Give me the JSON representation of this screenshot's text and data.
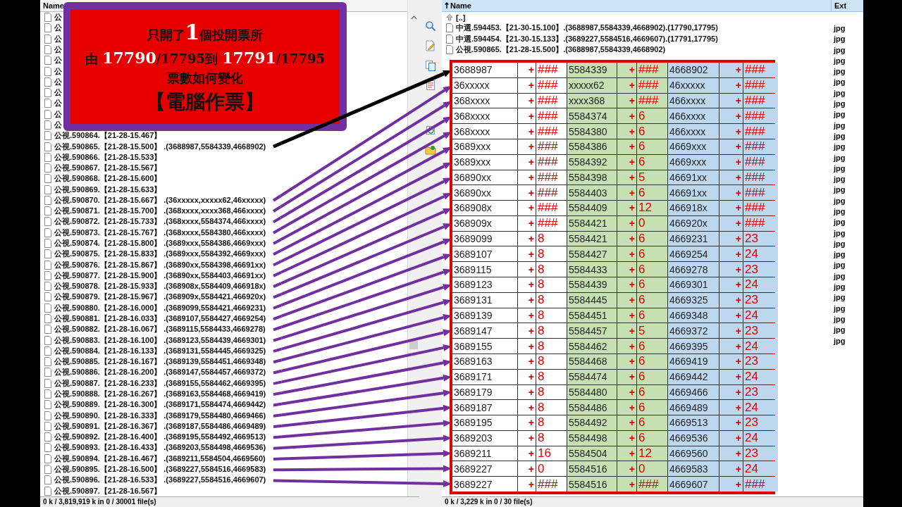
{
  "left_panel": {
    "header": "Name",
    "rows": [
      {
        "name": "公"
      },
      {
        "name": "公"
      },
      {
        "name": "公"
      },
      {
        "name": "公"
      },
      {
        "name": "公"
      },
      {
        "name": "公"
      },
      {
        "name": "公"
      },
      {
        "name": "公"
      },
      {
        "name": "公"
      },
      {
        "name": "公"
      },
      {
        "name": "公"
      },
      {
        "name": "公視.590864.【21-28-15.467】"
      },
      {
        "name": "公視.590865.【21-28-15.500】 .(3688987,5584339,4668902)",
        "color": "#000000"
      },
      {
        "name": "公視.590866.【21-28-15.533】"
      },
      {
        "name": "公視.590867.【21-28-15.567】"
      },
      {
        "name": "公視.590868.【21-28-15.600】"
      },
      {
        "name": "公視.590869.【21-28-15.633】"
      },
      {
        "name": "公視.590870.【21-28-15.667】 .(36xxxxx,xxxxx62,46xxxxx)",
        "color": "#7030a0"
      },
      {
        "name": "公視.590871.【21-28-15.700】 .(368xxxx,xxxx368,466xxxx)",
        "color": "#7030a0"
      },
      {
        "name": "公視.590872.【21-28-15.733】 .(368xxxx,5584374,466xxxx)",
        "color": "#7030a0"
      },
      {
        "name": "公視.590873.【21-28-15.767】 .(368xxxx,5584380,466xxxx)",
        "color": "#7030a0"
      },
      {
        "name": "公視.590874.【21-28-15.800】 .(3689xxx,5584386,4669xxx)",
        "color": "#7030a0"
      },
      {
        "name": "公視.590875.【21-28-15.833】 .(3689xxx,5584392,4669xxx)",
        "color": "#7030a0"
      },
      {
        "name": "公視.590876.【21-28-15.867】 .(36890xx,5584398,46691xx)",
        "color": "#7030a0"
      },
      {
        "name": "公視.590877.【21-28-15.900】 .(36890xx,5584403,46691xx)",
        "color": "#7030a0"
      },
      {
        "name": "公視.590878.【21-28-15.933】 .(368908x,5584409,466918x)",
        "color": "#7030a0"
      },
      {
        "name": "公視.590879.【21-28-15.967】 .(368909x,5584421,466920x)",
        "color": "#7030a0"
      },
      {
        "name": "公視.590880.【21-28-16.000】 .(3689099,5584421,4669231)",
        "color": "#7030a0"
      },
      {
        "name": "公視.590881.【21-28-16.033】 .(3689107,5584427,4669254)",
        "color": "#7030a0"
      },
      {
        "name": "公視.590882.【21-28-16.067】 .(3689115,5584433,4669278)",
        "color": "#7030a0"
      },
      {
        "name": "公視.590883.【21-28-16.100】 .(3689123,5584439,4669301)",
        "color": "#7030a0"
      },
      {
        "name": "公視.590884.【21-28-16.133】 .(3689131,5584445,4669325)",
        "color": "#7030a0"
      },
      {
        "name": "公視.590885.【21-28-16.167】 .(3689139,5584451,4669348)",
        "color": "#7030a0"
      },
      {
        "name": "公視.590886.【21-28-16.200】 .(3689147,5584457,4669372)",
        "color": "#7030a0"
      },
      {
        "name": "公視.590887.【21-28-16.233】 .(3689155,5584462,4669395)",
        "color": "#7030a0"
      },
      {
        "name": "公視.590888.【21-28-16.267】 .(3689163,5584468,4669419)",
        "color": "#7030a0"
      },
      {
        "name": "公視.590889.【21-28-16.300】 .(3689171,5584474,4669442)",
        "color": "#7030a0"
      },
      {
        "name": "公視.590890.【21-28-16.333】 .(3689179,5584480,4669466)",
        "color": "#7030a0"
      },
      {
        "name": "公視.590891.【21-28-16.367】 .(3689187,5584486,4669489)",
        "color": "#7030a0"
      },
      {
        "name": "公視.590892.【21-28-16.400】 .(3689195,5584492,4669513)",
        "color": "#7030a0"
      },
      {
        "name": "公視.590893.【21-28-16.433】 .(3689203,5584498,4669536)",
        "color": "#7030a0"
      },
      {
        "name": "公視.590894.【21-28-16.467】 .(3689211,5584504,4669560)",
        "color": "#7030a0"
      },
      {
        "name": "公視.590895.【21-28-16.500】 .(3689227,5584516,4669583)",
        "color": "#7030a0"
      },
      {
        "name": "公視.590896.【21-28-16.533】 .(3689227,5584516,4669607)",
        "color": "#7030a0"
      },
      {
        "name": "公視.590897.【21-28-16.567】"
      }
    ],
    "status": "0 k / 3,819,919 k in 0 / 30001 file(s)"
  },
  "right_panel": {
    "header_name": "Name",
    "header_ext": "Ext",
    "parent": "[..]",
    "rows": [
      {
        "name": "中選.594453.【21-30-15.100】.(3688987,5584339,4668902).(17790,17795)",
        "ext": "jpg"
      },
      {
        "name": "中選.594454.【21-30-15.133】.(3689227,5584516,4669607).(17791,17795)",
        "ext": "jpg"
      },
      {
        "name": "公視.590865.【21-28-15.500】.(3688987,5584339,4668902)",
        "ext": "jpg"
      },
      {
        "ext": "jpg"
      },
      {
        "ext": "jpg"
      },
      {
        "ext": "jpg"
      },
      {
        "ext": "jpg"
      },
      {
        "ext": "jpg"
      },
      {
        "ext": "jpg"
      },
      {
        "ext": "jpg"
      },
      {
        "ext": "jpg"
      },
      {
        "ext": "jpg"
      },
      {
        "ext": "jpg"
      },
      {
        "ext": "jpg"
      },
      {
        "ext": "jpg"
      },
      {
        "ext": "jpg"
      },
      {
        "ext": "jpg"
      },
      {
        "ext": "jpg"
      },
      {
        "ext": "jpg"
      },
      {
        "ext": "jpg"
      },
      {
        "ext": "jpg"
      },
      {
        "ext": "jpg"
      },
      {
        "ext": "jpg"
      },
      {
        "ext": "jpg"
      },
      {
        "ext": "jpg"
      },
      {
        "ext": "jpg"
      },
      {
        "ext": "jpg"
      },
      {
        "ext": "jpg"
      },
      {
        "ext": "jpg"
      },
      {
        "ext": "jpg"
      }
    ],
    "status": "0 k / 3,229 k in 0 / 30 file(s)"
  },
  "callout": {
    "lines": [
      {
        "kind": "normal",
        "parts": [
          {
            "text": "只開了",
            "kind": "plain"
          },
          {
            "text": "1",
            "kind": "big"
          },
          {
            "text": "個投開票所",
            "kind": "plain"
          }
        ]
      },
      {
        "kind": "normal",
        "parts": [
          {
            "text": "由 ",
            "kind": "plain"
          },
          {
            "text": "17790",
            "kind": "light"
          },
          {
            "text": "/17795到 ",
            "kind": "plain"
          },
          {
            "text": "17791",
            "kind": "light"
          },
          {
            "text": "/17795",
            "kind": "plain"
          }
        ]
      },
      {
        "kind": "normal",
        "parts": [
          {
            "text": "票數如何變化",
            "kind": "plain"
          }
        ]
      },
      {
        "kind": "large",
        "parts": [
          {
            "text": "【電腦作票】",
            "kind": "plain"
          }
        ]
      }
    ]
  },
  "vote_table": {
    "rows": [
      [
        "3688987",
        "+",
        "###",
        "5584339",
        "+",
        "###",
        "4668902",
        "+",
        "###"
      ],
      [
        "36xxxxx",
        "+",
        "###",
        "xxxxx62",
        "+",
        "###",
        "46xxxxx",
        "+",
        "###"
      ],
      [
        "368xxxx",
        "+",
        "###",
        "xxxx368",
        "+",
        "###",
        "466xxxx",
        "+",
        "###"
      ],
      [
        "368xxxx",
        "+",
        "###",
        "5584374",
        "+",
        "6",
        "466xxxx",
        "+",
        "###"
      ],
      [
        "368xxxx",
        "+",
        "###",
        "5584380",
        "+",
        "6",
        "466xxxx",
        "+",
        "###"
      ],
      [
        "3689xxx",
        "+",
        "###",
        "5584386",
        "+",
        "6",
        "4669xxx",
        "+",
        "###"
      ],
      [
        "3689xxx",
        "+",
        "###",
        "5584392",
        "+",
        "6",
        "4669xxx",
        "+",
        "###"
      ],
      [
        "36890xx",
        "+",
        "###",
        "5584398",
        "+",
        "5",
        "46691xx",
        "+",
        "###"
      ],
      [
        "36890xx",
        "+",
        "###",
        "5584403",
        "+",
        "6",
        "46691xx",
        "+",
        "###"
      ],
      [
        "368908x",
        "+",
        "###",
        "5584409",
        "+",
        "12",
        "466918x",
        "+",
        "###"
      ],
      [
        "368909x",
        "+",
        "###",
        "5584421",
        "+",
        "0",
        "466920x",
        "+",
        "###"
      ],
      [
        "3689099",
        "+",
        "8",
        "5584421",
        "+",
        "6",
        "4669231",
        "+",
        "23"
      ],
      [
        "3689107",
        "+",
        "8",
        "5584427",
        "+",
        "6",
        "4669254",
        "+",
        "24"
      ],
      [
        "3689115",
        "+",
        "8",
        "5584433",
        "+",
        "6",
        "4669278",
        "+",
        "23"
      ],
      [
        "3689123",
        "+",
        "8",
        "5584439",
        "+",
        "6",
        "4669301",
        "+",
        "24"
      ],
      [
        "3689131",
        "+",
        "8",
        "5584445",
        "+",
        "6",
        "4669325",
        "+",
        "23"
      ],
      [
        "3689139",
        "+",
        "8",
        "5584451",
        "+",
        "6",
        "4669348",
        "+",
        "24"
      ],
      [
        "3689147",
        "+",
        "8",
        "5584457",
        "+",
        "5",
        "4669372",
        "+",
        "23"
      ],
      [
        "3689155",
        "+",
        "8",
        "5584462",
        "+",
        "6",
        "4669395",
        "+",
        "24"
      ],
      [
        "3689163",
        "+",
        "8",
        "5584468",
        "+",
        "6",
        "4669419",
        "+",
        "23"
      ],
      [
        "3689171",
        "+",
        "8",
        "5584474",
        "+",
        "6",
        "4669442",
        "+",
        "24"
      ],
      [
        "3689179",
        "+",
        "8",
        "5584480",
        "+",
        "6",
        "4669466",
        "+",
        "23"
      ],
      [
        "3689187",
        "+",
        "8",
        "5584486",
        "+",
        "6",
        "4669489",
        "+",
        "24"
      ],
      [
        "3689195",
        "+",
        "8",
        "5584492",
        "+",
        "6",
        "4669513",
        "+",
        "23"
      ],
      [
        "3689203",
        "+",
        "8",
        "5584498",
        "+",
        "6",
        "4669536",
        "+",
        "24"
      ],
      [
        "3689211",
        "+",
        "16",
        "5584504",
        "+",
        "12",
        "4669560",
        "+",
        "23"
      ],
      [
        "3689227",
        "+",
        "0",
        "5584516",
        "+",
        "0",
        "4669583",
        "+",
        "24"
      ],
      [
        "3689227",
        "+",
        "###",
        "5584516",
        "+",
        "###",
        "4669607",
        "+",
        "###"
      ]
    ]
  }
}
